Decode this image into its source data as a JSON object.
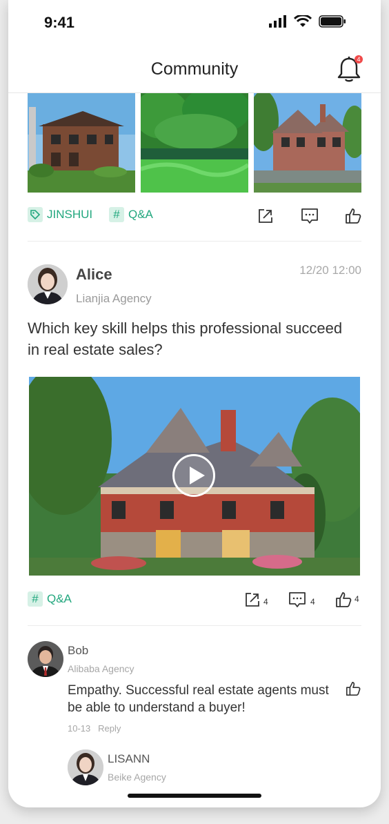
{
  "status": {
    "time": "9:41"
  },
  "nav": {
    "title": "Community",
    "notification_count": "4"
  },
  "post1": {
    "tags": [
      {
        "icon": "tag-icon",
        "label": "JINSHUI"
      },
      {
        "icon": "hash-icon",
        "label": "Q&A"
      }
    ]
  },
  "post2": {
    "author": "Alice",
    "agency": "Lianjia Agency",
    "timestamp": "12/20 12:00",
    "question": "Which key skill helps this professional succeed in real estate sales?",
    "tag": "Q&A",
    "shares": "4",
    "comments": "4",
    "likes": "4"
  },
  "reply1": {
    "author": "Bob",
    "agency": "Alibaba Agency",
    "text": "Empathy. Successful real estate agents must be able to understand a buyer!",
    "date": "10-13",
    "reply_label": "Reply"
  },
  "reply2": {
    "author": "LISANN",
    "agency": "Beike Agency"
  },
  "colors": {
    "accent": "#22a77e",
    "badge": "#f04a4a"
  }
}
